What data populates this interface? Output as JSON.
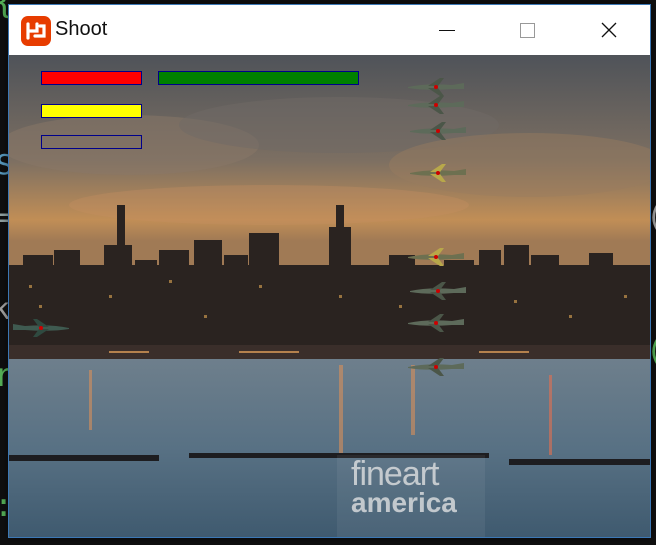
{
  "window": {
    "title": "Shoot"
  },
  "controls": {
    "minimize": "minimize",
    "maximize": "maximize",
    "close": "close"
  },
  "hud": {
    "bars": [
      {
        "name": "red-bar",
        "color": "#ff0000",
        "level": 1.0
      },
      {
        "name": "green-bar",
        "color": "#008000",
        "level": 1.0
      },
      {
        "name": "yellow-bar",
        "color": "#ffff00",
        "level": 1.0
      },
      {
        "name": "empty-bar",
        "color": "#000000",
        "level": 0.0
      }
    ]
  },
  "enemies": {
    "count": 9,
    "plane_icon": "fighter-plane-icon"
  },
  "player": {
    "plane_icon": "player-plane-icon"
  },
  "watermark": {
    "line1": "fineart",
    "line2": "america"
  },
  "colors": {
    "sky": "#6b6c70",
    "water": "#4f6b80",
    "bar_border": "#00008b"
  }
}
